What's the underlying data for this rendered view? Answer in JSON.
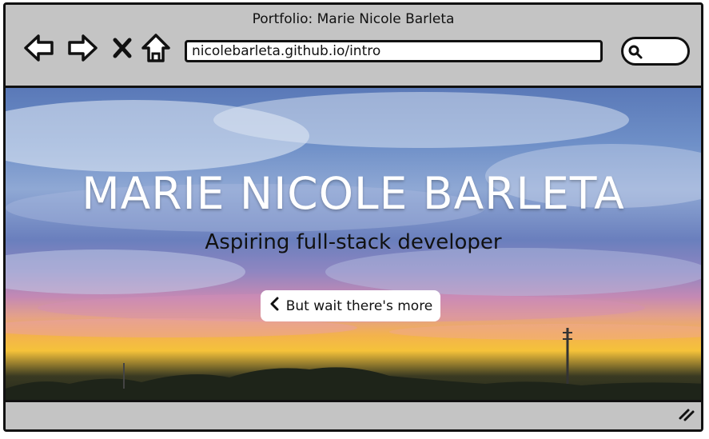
{
  "window": {
    "title": "Portfolio: Marie Nicole Barleta"
  },
  "browser": {
    "url": "nicolebarleta.github.io/intro",
    "nav": [
      "back-icon",
      "forward-icon",
      "close-icon",
      "home-icon"
    ],
    "search_icon": "search-icon"
  },
  "hero": {
    "title": "MARIE NICOLE BARLETA",
    "subtitle": "Aspiring full-stack developer",
    "button_label": "But wait there's more",
    "button_icon": "chevron-left-icon"
  },
  "colors": {
    "chrome": "#c4c4c4",
    "outline": "#111111",
    "hero_title": "#ffffff",
    "button_bg": "#ffffff"
  }
}
